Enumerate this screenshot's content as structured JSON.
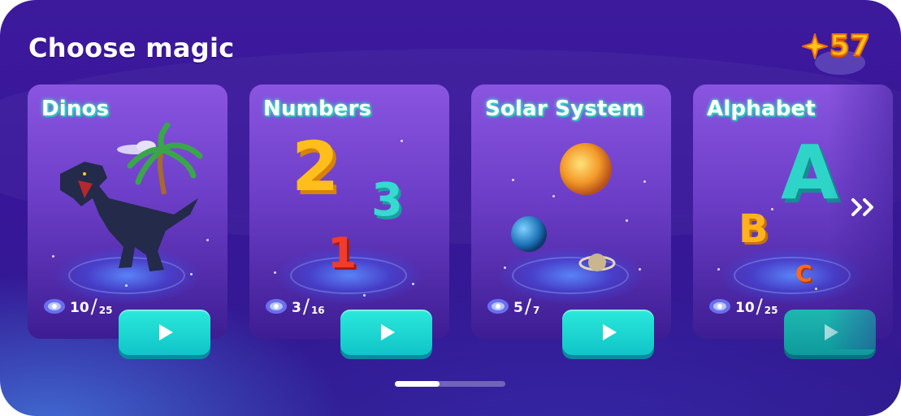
{
  "header": {
    "title": "Choose magic",
    "score": "57",
    "score_icon": "star-icon"
  },
  "cards": [
    {
      "name": "Dinos",
      "current": "10",
      "total": "25",
      "play_icon": "play-icon"
    },
    {
      "name": "Numbers",
      "current": "3",
      "total": "16",
      "play_icon": "play-icon",
      "glyphs": [
        "2",
        "3",
        "1"
      ]
    },
    {
      "name": "Solar System",
      "current": "5",
      "total": "7",
      "play_icon": "play-icon"
    },
    {
      "name": "Alphabet",
      "current": "10",
      "total": "25",
      "play_icon": "play-icon",
      "glyphs": [
        "A",
        "B",
        "C"
      ]
    }
  ],
  "carousel": {
    "next_icon": "double-chevron-right-icon",
    "page_indicator": "1 of 3"
  },
  "colors": {
    "accent": "#1fd6d0",
    "score": "#ffc21a",
    "background": "#3a1a9a"
  }
}
